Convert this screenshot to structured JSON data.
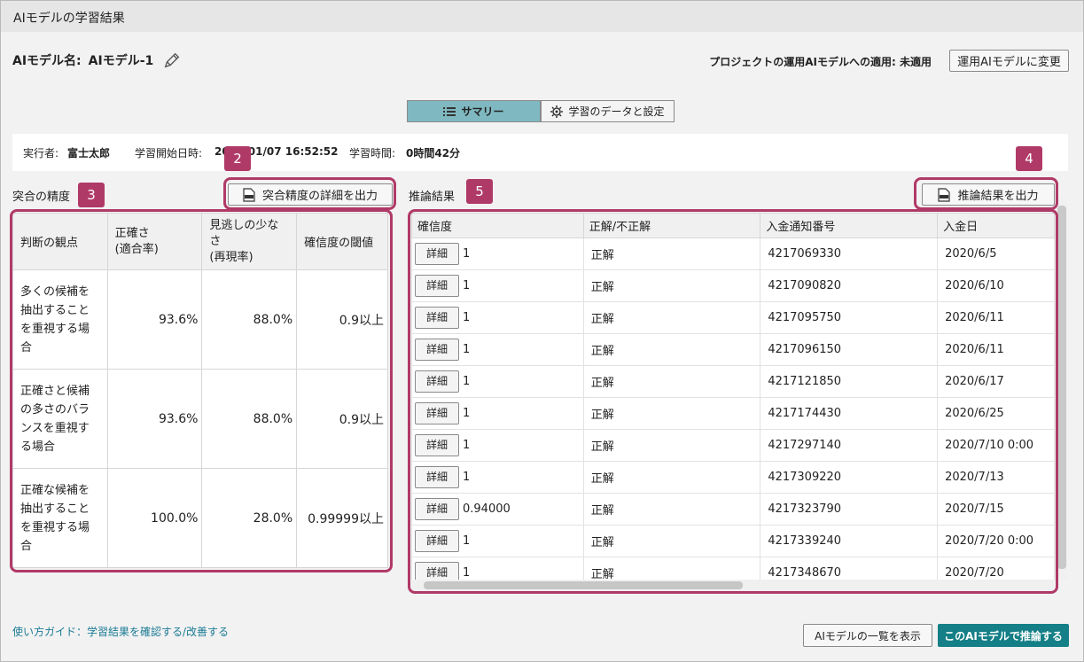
{
  "window": {
    "title": "AIモデルの学習結果"
  },
  "model": {
    "name_label": "AIモデル名:",
    "name_value": "AIモデル-1"
  },
  "apply": {
    "status": "プロジェクトの運用AIモデルへの適用: 未適用",
    "change_button": "運用AIモデルに変更"
  },
  "tabs": [
    {
      "label": "サマリー",
      "icon": "list-icon",
      "active": true
    },
    {
      "label": "学習のデータと設定",
      "icon": "gear-icon",
      "active": false
    }
  ],
  "info": {
    "executor_label": "実行者:",
    "executor": "富士太郎",
    "start_label": "学習開始日時:",
    "start": "2020/01/07 16:52:52",
    "duration_label": "学習時間:",
    "duration": "0時間42分"
  },
  "accuracy": {
    "title": "突合の精度",
    "export_button": "突合精度の詳細を出力",
    "headers": [
      "判断の観点",
      "正確さ\n(適合率)",
      "見逃しの少なさ\n(再現率)",
      "確信度の閾値"
    ],
    "rows": [
      {
        "label": "多くの候補を抽出することを重視する場合",
        "precision": "93.6%",
        "recall": "88.0%",
        "threshold": "0.9以上"
      },
      {
        "label": "正確さと候補の多さのバランスを重視する場合",
        "precision": "93.6%",
        "recall": "88.0%",
        "threshold": "0.9以上"
      },
      {
        "label": "正確な候補を抽出することを重視する場合",
        "precision": "100.0%",
        "recall": "28.0%",
        "threshold": "0.99999以上"
      }
    ]
  },
  "results": {
    "title": "推論結果",
    "export_button": "推論結果を出力",
    "detail_label": "詳細",
    "headers": [
      "確信度",
      "正解/不正解",
      "入金通知番号",
      "入金日"
    ],
    "rows": [
      {
        "confidence": "1",
        "correct": "正解",
        "number": "4217069330",
        "date": "2020/6/5"
      },
      {
        "confidence": "1",
        "correct": "正解",
        "number": "4217090820",
        "date": "2020/6/10"
      },
      {
        "confidence": "1",
        "correct": "正解",
        "number": "4217095750",
        "date": "2020/6/11"
      },
      {
        "confidence": "1",
        "correct": "正解",
        "number": "4217096150",
        "date": "2020/6/11"
      },
      {
        "confidence": "1",
        "correct": "正解",
        "number": "4217121850",
        "date": "2020/6/17"
      },
      {
        "confidence": "1",
        "correct": "正解",
        "number": "4217174430",
        "date": "2020/6/25"
      },
      {
        "confidence": "1",
        "correct": "正解",
        "number": "4217297140",
        "date": "2020/7/10 0:00"
      },
      {
        "confidence": "1",
        "correct": "正解",
        "number": "4217309220",
        "date": "2020/7/13"
      },
      {
        "confidence": "0.94000",
        "correct": "正解",
        "number": "4217323790",
        "date": "2020/7/15"
      },
      {
        "confidence": "1",
        "correct": "正解",
        "number": "4217339240",
        "date": "2020/7/20 0:00"
      },
      {
        "confidence": "1",
        "correct": "正解",
        "number": "4217348670",
        "date": "2020/7/20"
      }
    ]
  },
  "badges": [
    "2",
    "3",
    "4",
    "5"
  ],
  "footer": {
    "guide_link": "使い方ガイド：学習結果を確認する/改善する",
    "list_button": "AIモデルの一覧を表示",
    "infer_button": "このAIモデルで推論する"
  },
  "colors": {
    "highlight": "#b03a67",
    "primary": "#147f86",
    "tab_active": "#7fb8c0",
    "link": "#1c7b95"
  }
}
